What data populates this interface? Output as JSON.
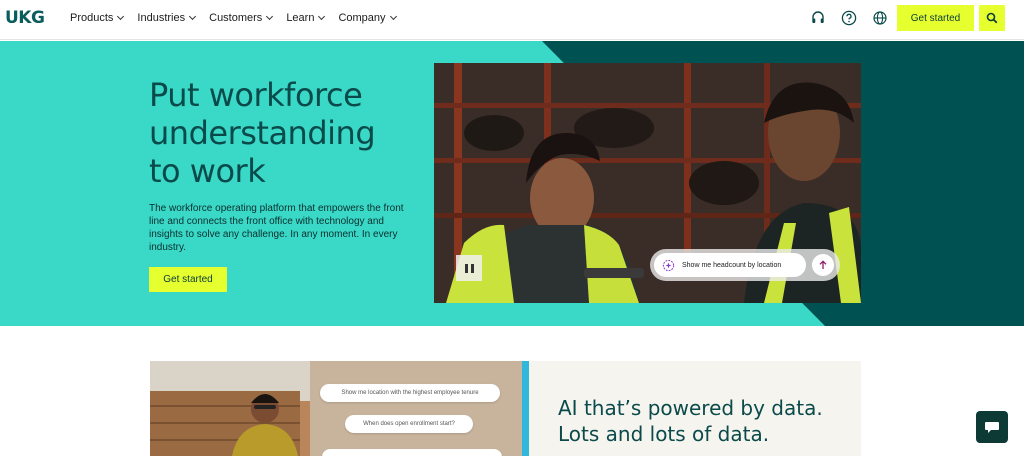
{
  "header": {
    "logo": "UKG",
    "nav": [
      {
        "label": "Products"
      },
      {
        "label": "Industries"
      },
      {
        "label": "Customers"
      },
      {
        "label": "Learn"
      },
      {
        "label": "Company"
      }
    ],
    "icons": [
      "headset-icon",
      "help-icon",
      "globe-icon"
    ],
    "cta_label": "Get started",
    "search_icon": "search-icon"
  },
  "hero": {
    "title_lines": [
      "Put workforce",
      "understanding",
      "to work"
    ],
    "subtitle": "The workforce operating platform that empowers the front line and connects the front office with technology and insights to solve any challenge. In any moment. In every industry.",
    "cta_label": "Get started",
    "video": {
      "ai_prompt": "Show me headcount by location",
      "pause_icon": "pause-icon",
      "send_icon": "arrow-up-icon"
    }
  },
  "lower": {
    "bubbles": [
      "Show me location with the highest employee tenure",
      "When does open enrollment start?"
    ],
    "title_lines": [
      "AI that’s powered by data.",
      "Lots and lots of data."
    ]
  },
  "chat_icon": "chat-icon",
  "colors": {
    "accent": "#e6ff2e",
    "teal": "#3ad8c6",
    "dark_teal": "#005151",
    "text_dark": "#0b4a4a",
    "blue_stripe": "#31b7d9"
  }
}
